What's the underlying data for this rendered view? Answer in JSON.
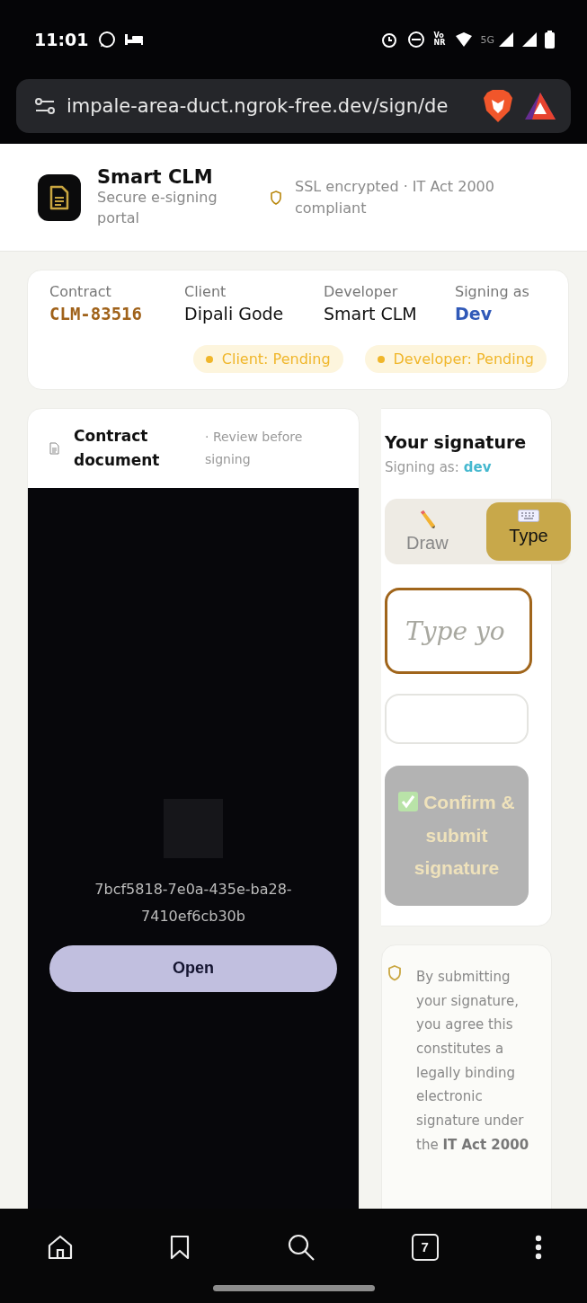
{
  "status_bar": {
    "time": "11:01",
    "network_label": "VoNR",
    "network_type": "5G"
  },
  "browser": {
    "url": "impale-area-duct.ngrok-free.dev/sign/de",
    "tab_count": "7"
  },
  "header": {
    "app_name": "Smart CLM",
    "tagline": "Secure e-signing portal",
    "security_note": "SSL encrypted · IT Act 2000 compliant"
  },
  "contract_info": {
    "fields": [
      {
        "label": "Contract",
        "value": "CLM-83516",
        "kind": "code"
      },
      {
        "label": "Client",
        "value": "Dipali Gode",
        "kind": "plain"
      },
      {
        "label": "Developer",
        "value": "Smart CLM",
        "kind": "plain"
      },
      {
        "label": "Signing as",
        "value": "Dev",
        "kind": "role"
      }
    ],
    "statuses": [
      {
        "label": "Client: Pending",
        "color": "#f0b62a"
      },
      {
        "label": "Developer: Pending",
        "color": "#f0b62a"
      }
    ]
  },
  "document": {
    "title": "Contract document",
    "subtitle": "· Review before signing",
    "file_name": "7bcf5818-7e0a-435e-ba28-7410ef6cb30b",
    "open_button": "Open"
  },
  "signature": {
    "title": "Your signature",
    "signing_as_label": "Signing as:",
    "signing_as_value": "dev",
    "modes": [
      {
        "label": "Draw",
        "kind": "draw",
        "selected": false
      },
      {
        "label": "Type",
        "kind": "type",
        "selected": true
      }
    ],
    "name_placeholder": "Type yo",
    "submit_button": "Confirm & submit signature",
    "submit_disabled": true
  },
  "legal_notice": "By submitting your signature, you agree this constitutes a legally binding electronic signature under the **IT Act 2000**"
}
